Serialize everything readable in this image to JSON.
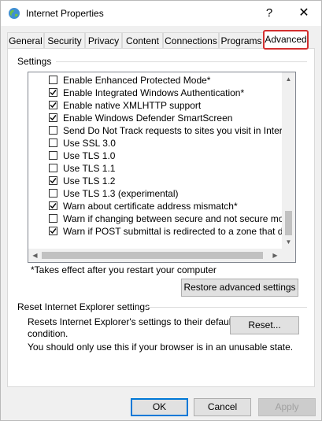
{
  "window": {
    "title": "Internet Properties",
    "help_label": "?",
    "close_label": "✕"
  },
  "tabs": [
    {
      "label": "General"
    },
    {
      "label": "Security"
    },
    {
      "label": "Privacy"
    },
    {
      "label": "Content"
    },
    {
      "label": "Connections"
    },
    {
      "label": "Programs"
    },
    {
      "label": "Advanced",
      "selected": true
    }
  ],
  "settings": {
    "group_label": "Settings",
    "items": [
      {
        "label": "Enable Enhanced Protected Mode*",
        "checked": false
      },
      {
        "label": "Enable Integrated Windows Authentication*",
        "checked": true
      },
      {
        "label": "Enable native XMLHTTP support",
        "checked": true
      },
      {
        "label": "Enable Windows Defender SmartScreen",
        "checked": true
      },
      {
        "label": "Send Do Not Track requests to sites you visit in Internet E",
        "checked": false
      },
      {
        "label": "Use SSL 3.0",
        "checked": false
      },
      {
        "label": "Use TLS 1.0",
        "checked": false
      },
      {
        "label": "Use TLS 1.1",
        "checked": false
      },
      {
        "label": "Use TLS 1.2",
        "checked": true
      },
      {
        "label": "Use TLS 1.3 (experimental)",
        "checked": false
      },
      {
        "label": "Warn about certificate address mismatch*",
        "checked": true
      },
      {
        "label": "Warn if changing between secure and not secure mode",
        "checked": false
      },
      {
        "label": "Warn if POST submittal is redirected to a zone that does n",
        "checked": true
      }
    ],
    "note": "*Takes effect after you restart your computer",
    "restore_button": "Restore advanced settings"
  },
  "reset": {
    "group_label": "Reset Internet Explorer settings",
    "description_line1": "Resets Internet Explorer's settings to their default",
    "description_line2": "condition.",
    "button": "Reset...",
    "warning": "You should only use this if your browser is in an unusable state."
  },
  "footer": {
    "ok": "OK",
    "cancel": "Cancel",
    "apply": "Apply"
  },
  "colors": {
    "highlight": "#d32f2f",
    "accent": "#0078d7"
  }
}
